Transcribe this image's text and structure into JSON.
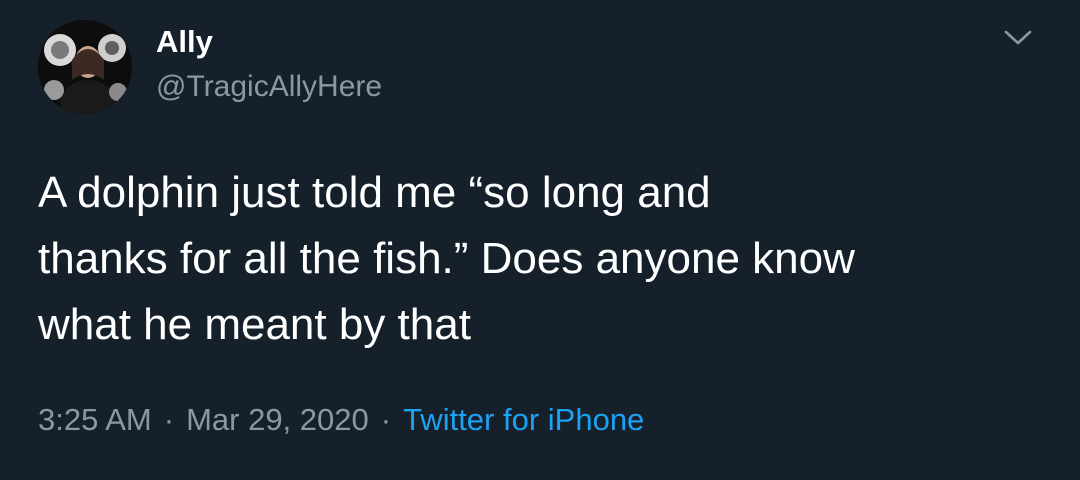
{
  "author": {
    "display_name": "Ally",
    "handle": "@TragicAllyHere",
    "avatar_icon": "profile-photo"
  },
  "tweet": {
    "text_lines": [
      "A dolphin just told me “so long and",
      "thanks for all the fish.” Does anyone know",
      "what he meant by that"
    ],
    "time": "3:25 AM",
    "separator": "·",
    "date": "Mar 29, 2020",
    "source": "Twitter for iPhone"
  },
  "menu_icon": "chevron-down-icon",
  "colors": {
    "background": "#15202b",
    "primary_text": "#ffffff",
    "secondary_text": "#8899a6",
    "link": "#1da1f2"
  }
}
